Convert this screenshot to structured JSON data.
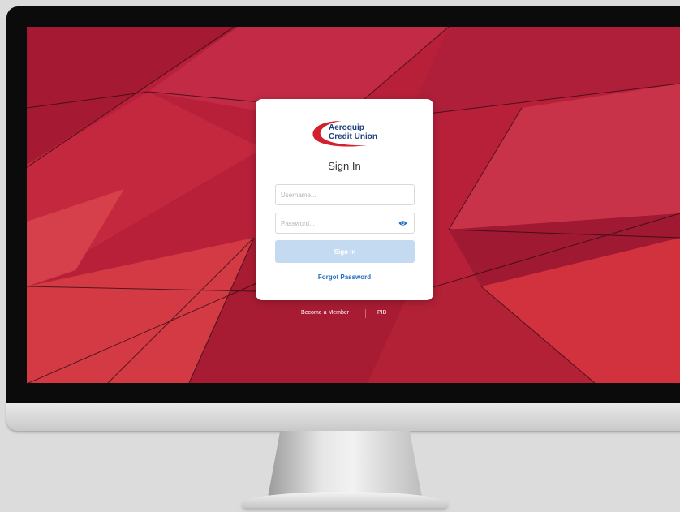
{
  "brand": {
    "line1": "Aeroquip",
    "line2": "Credit Union",
    "swoosh_color": "#d3202e",
    "text_color": "#1f3f7a"
  },
  "login": {
    "title": "Sign In",
    "username_placeholder": "Username...",
    "password_placeholder": "Password...",
    "password_toggle_icon": "eye-icon",
    "sign_in_label": "Sign In",
    "forgot_password_label": "Forgot Password"
  },
  "footer_links": {
    "become_member": "Become a Member",
    "pib": "PIB"
  },
  "colors": {
    "background_red": "#b8203a",
    "button_disabled": "#c4daf1",
    "link_blue": "#1f6fc2"
  }
}
